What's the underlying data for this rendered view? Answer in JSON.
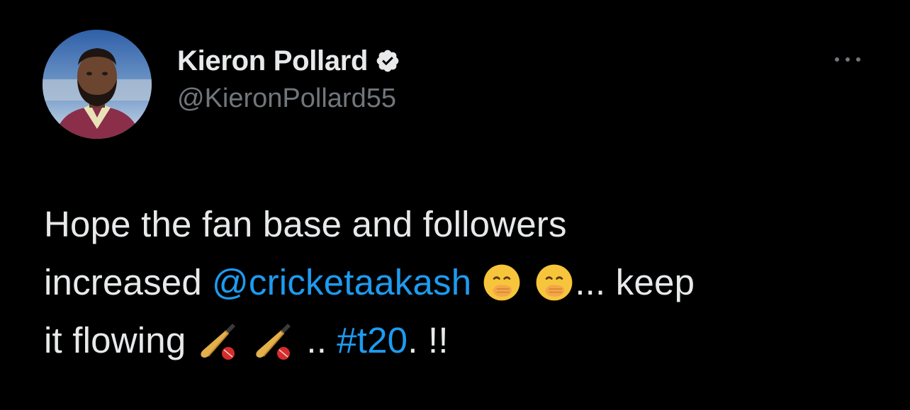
{
  "author": {
    "display_name": "Kieron Pollard",
    "handle": "@KieronPollard55",
    "verified": true,
    "verified_icon": "verified-badge-icon"
  },
  "more_menu_icon": "more-options-icon",
  "tweet": {
    "line1": "Hope the fan base and followers",
    "line2_text": "increased",
    "mention": "@cricketaakash",
    "emoji_1": "face-with-hand-over-mouth",
    "emoji_2": "face-with-hand-over-mouth",
    "line2_tail": "... keep",
    "line3_text": "it flowing",
    "emoji_3": "cricket-bat-and-ball",
    "emoji_4": "cricket-bat-and-ball",
    "line3_dots": "..",
    "hashtag": "#t20",
    "line3_tail": ". !!"
  },
  "colors": {
    "background": "#000000",
    "text_primary": "#e7e9ea",
    "text_secondary": "#71767b",
    "link": "#1d9bf0"
  }
}
